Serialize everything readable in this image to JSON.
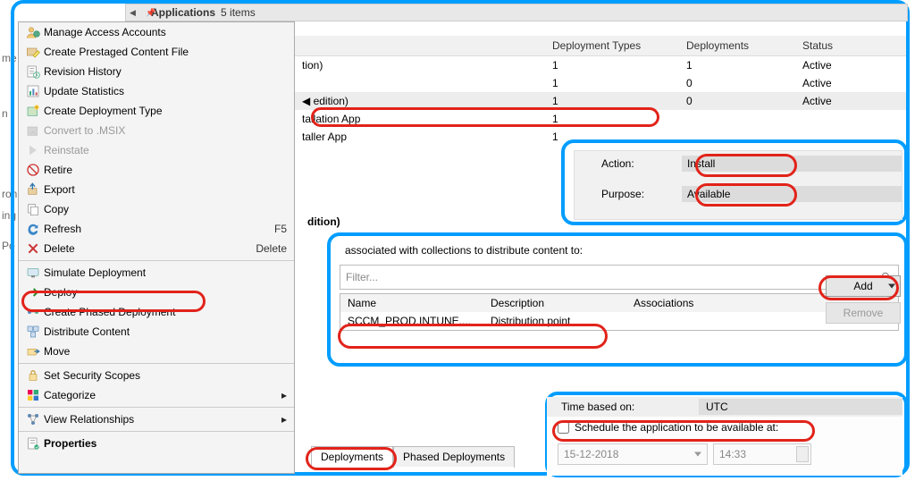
{
  "header": {
    "title": "Applications",
    "count": "5 items"
  },
  "edge": {
    "a": "me",
    "b": "n f",
    "c": "ron",
    "d": "ing",
    "e": "Po"
  },
  "menu": [
    {
      "icon": "user",
      "label": "Manage Access Accounts"
    },
    {
      "icon": "box-edit",
      "label": "Create Prestaged Content File"
    },
    {
      "icon": "history",
      "label": "Revision History"
    },
    {
      "icon": "chart",
      "label": "Update Statistics"
    },
    {
      "icon": "create",
      "label": "Create Deployment Type"
    },
    {
      "icon": "convert",
      "label": "Convert to .MSIX",
      "gray": true
    },
    {
      "icon": "reinstate",
      "label": "Reinstate",
      "gray": true
    },
    {
      "icon": "retire",
      "label": "Retire"
    },
    {
      "icon": "export",
      "label": "Export"
    },
    {
      "icon": "copy",
      "label": "Copy"
    },
    {
      "icon": "refresh",
      "label": "Refresh",
      "shortcut": "F5"
    },
    {
      "icon": "delete",
      "label": "Delete",
      "shortcut": "Delete"
    },
    {
      "sep": true
    },
    {
      "icon": "sim",
      "label": "Simulate Deployment"
    },
    {
      "icon": "deploy",
      "label": "Deploy"
    },
    {
      "icon": "phased",
      "label": "Create Phased Deployment"
    },
    {
      "icon": "distribute",
      "label": "Distribute Content"
    },
    {
      "icon": "move",
      "label": "Move"
    },
    {
      "sep": true
    },
    {
      "icon": "scope",
      "label": "Set Security Scopes"
    },
    {
      "icon": "categorize",
      "label": "Categorize",
      "sub": true
    },
    {
      "sep": true
    },
    {
      "icon": "relations",
      "label": "View Relationships",
      "sub": true
    },
    {
      "sep": true
    },
    {
      "icon": "props",
      "label": "Properties",
      "bold": true
    }
  ],
  "grid": {
    "columns": [
      "",
      "Deployment Types",
      "Deployments",
      "Status"
    ],
    "rows": [
      {
        "name": "tion)",
        "dt": "1",
        "dep": "1",
        "st": "Active"
      },
      {
        "name": "",
        "dt": "1",
        "dep": "0",
        "st": "Active"
      },
      {
        "name": "edition)",
        "dt": "1",
        "dep": "0",
        "st": "Active",
        "sel": true,
        "pre": "◀"
      },
      {
        "name": "tallation App",
        "dt": "1",
        "dep": "",
        "st": ""
      },
      {
        "name": "taller App",
        "dt": "1",
        "dep": "",
        "st": ""
      }
    ]
  },
  "section_title": "dition)",
  "ap": {
    "action_lbl": "Action:",
    "action_val": "Install",
    "purpose_lbl": "Purpose:",
    "purpose_val": "Available"
  },
  "dp": {
    "caption": "associated with collections to distribute content to:",
    "filter_placeholder": "Filter...",
    "col_name": "Name",
    "col_desc": "Description",
    "col_assoc": "Associations",
    "row_name": "SCCM_PROD.INTUNE....",
    "row_desc": "Distribution point",
    "add": "Add",
    "remove": "Remove"
  },
  "tabs": {
    "deployments": "Deployments",
    "phased": "Phased Deployments"
  },
  "tp": {
    "time_based": "Time based on:",
    "utc": "UTC",
    "schedule": "Schedule the application to be available at:",
    "date": "15-12-2018",
    "time": "14:33"
  }
}
